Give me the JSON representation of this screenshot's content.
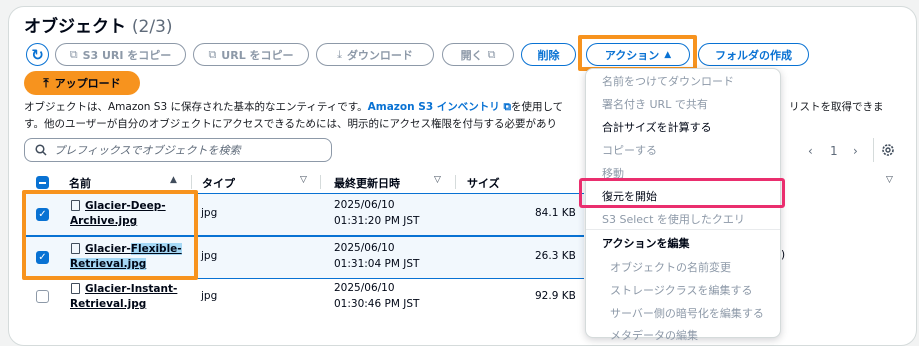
{
  "header": {
    "title": "オブジェクト",
    "count": "(2/3)"
  },
  "toolbar": {
    "copy_s3_uri": "S3 URI をコピー",
    "copy_url": "URL をコピー",
    "download": "ダウンロード",
    "open": "開く",
    "delete": "削除",
    "actions": "アクション",
    "create_folder": "フォルダの作成",
    "upload": "アップロード"
  },
  "description": {
    "line1_a": "オブジェクトは、Amazon S3 に保存された基本的なエンティティです。",
    "link": "Amazon S3 インベントリ",
    "line1_b": "を使用して",
    "line1_c": "リストを取得できま",
    "line2": "す。他のユーザーが自分のオブジェクトにアクセスできるためには、明示的にアクセス権限を付与する必要があり"
  },
  "search": {
    "placeholder": "プレフィックスでオブジェクトを検索"
  },
  "pagination": {
    "page": "1"
  },
  "table": {
    "columns": {
      "name": "名前",
      "type": "タイプ",
      "modified": "最終更新日時",
      "size": "サイズ"
    },
    "rows": [
      {
        "name_line1": "Glacier-Deep-",
        "name_line2": "Archive.jpg",
        "type": "jpg",
        "date": "2025/06/10",
        "time": "01:31:20 PM JST",
        "size": "84.1 KB",
        "selected": true
      },
      {
        "name_line1_a": "Glacier-",
        "name_line1_b": "Flexible-",
        "name_line2": "Retrieval.jpg",
        "type": "jpg",
        "date": "2025/06/10",
        "time": "01:31:04 PM JST",
        "size": "26.3 KB",
        "selected": true,
        "extra": ")"
      },
      {
        "name_line1": "Glacier-Instant-",
        "name_line2": "Retrieval.jpg",
        "type": "jpg",
        "date": "2025/06/10",
        "time": "01:30:46 PM JST",
        "size": "92.9 KB",
        "selected": false
      }
    ]
  },
  "menu": {
    "download_as": "名前をつけてダウンロード",
    "share_presigned": "署名付き URL で共有",
    "calc_total_size": "合計サイズを計算する",
    "copy": "コピーする",
    "move": "移動",
    "initiate_restore": "復元を開始",
    "s3_select": "S3 Select を使用したクエリ",
    "edit_actions_header": "アクションを編集",
    "rename": "オブジェクトの名前変更",
    "edit_storage_class": "ストレージクラスを編集する",
    "edit_encryption": "サーバー側の暗号化を編集する",
    "edit_metadata": "メタデータの編集"
  },
  "colors": {
    "accent": "#0972d3",
    "highlight_orange": "#f7931e",
    "highlight_pink": "#ea2e6e"
  }
}
